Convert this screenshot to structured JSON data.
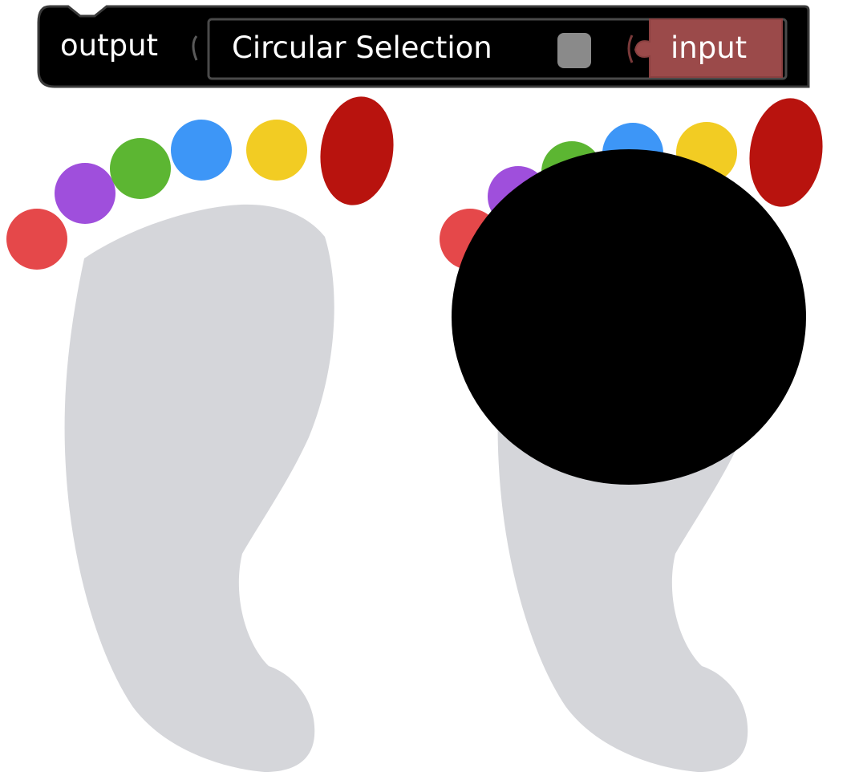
{
  "block": {
    "output_label": "output",
    "title": "Circular Selection",
    "input_label": "input",
    "colors": {
      "block_bg": "#000000",
      "block_border": "#3a3a3a",
      "toggle": "#8a8a8a",
      "input_port": "#9b4a4a"
    }
  },
  "canvas": {
    "toe_colors": [
      "#e5484a",
      "#9f4fdc",
      "#5cb632",
      "#3d96f7",
      "#f2cc23",
      "#b8130e"
    ],
    "foot_color": "#d5d6da",
    "selection_color": "#000000"
  }
}
